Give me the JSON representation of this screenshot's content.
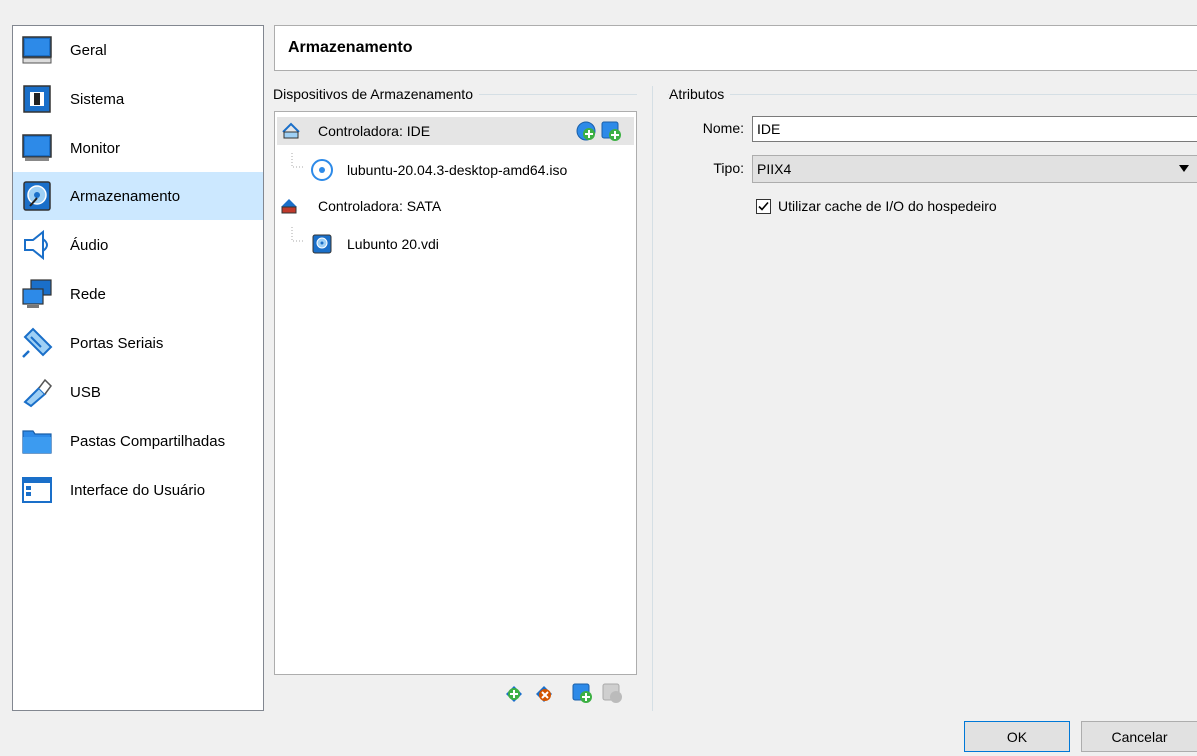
{
  "sidebar": {
    "items": [
      {
        "label": "Geral",
        "icon": "monitor-general-icon"
      },
      {
        "label": "Sistema",
        "icon": "chip-icon"
      },
      {
        "label": "Monitor",
        "icon": "display-icon"
      },
      {
        "label": "Armazenamento",
        "icon": "disk-storage-icon",
        "selected": true
      },
      {
        "label": "Áudio",
        "icon": "speaker-icon"
      },
      {
        "label": "Rede",
        "icon": "network-icon"
      },
      {
        "label": "Portas Seriais",
        "icon": "serial-port-icon"
      },
      {
        "label": "USB",
        "icon": "usb-icon"
      },
      {
        "label": "Pastas Compartilhadas",
        "icon": "folder-icon"
      },
      {
        "label": "Interface do Usuário",
        "icon": "window-icon"
      }
    ]
  },
  "header": {
    "title": "Armazenamento"
  },
  "storage": {
    "group_label": "Dispositivos de Armazenamento",
    "tree": [
      {
        "label": "Controladora: IDE",
        "type": "controller"
      },
      {
        "label": "lubuntu-20.04.3-desktop-amd64.iso",
        "type": "optical"
      },
      {
        "label": "Controladora: SATA",
        "type": "controller"
      },
      {
        "label": "Lubunto 20.vdi",
        "type": "harddisk"
      }
    ]
  },
  "attributes": {
    "group_label": "Atributos",
    "name_label": "Nome:",
    "name_value": "IDE",
    "type_label": "Tipo:",
    "type_value": "PIIX4",
    "cache_label": "Utilizar cache de I/O do hospedeiro",
    "cache_checked": true
  },
  "buttons": {
    "ok": "OK",
    "cancel": "Cancelar"
  },
  "colors": {
    "selection": "#cce8ff",
    "accent": "#0078d7",
    "tree_selected": "#e5e5e5"
  }
}
